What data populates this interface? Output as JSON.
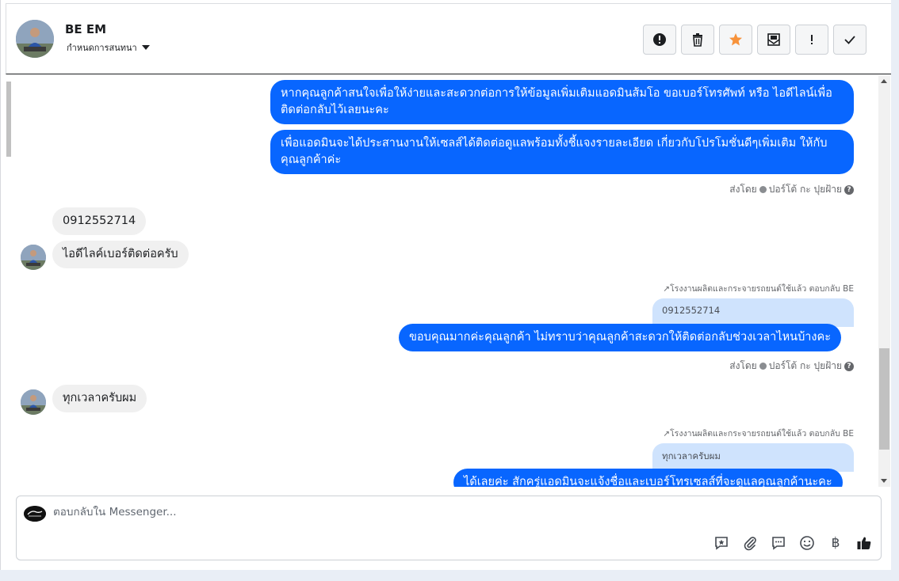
{
  "header": {
    "contact_name": "BE EM",
    "assign_label": "กำหนดการสนทนา"
  },
  "toolbar": {
    "buttons": [
      {
        "name": "report-spam",
        "icon": "alert-circle-icon"
      },
      {
        "name": "delete",
        "icon": "trash-icon"
      },
      {
        "name": "star",
        "icon": "star-icon",
        "color": "#f7923a"
      },
      {
        "name": "mark-unread",
        "icon": "envelope-icon"
      },
      {
        "name": "important",
        "icon": "exclamation-icon"
      },
      {
        "name": "mark-done",
        "icon": "checkmark-icon"
      }
    ]
  },
  "messages": {
    "m1": "หากคุณลูกค้าสนใจเพื่อให้ง่ายและสะดวกต่อการให้ข้อมูลเพิ่มเติมแอดมินส้มโอ ขอเบอร์โทรศัพท์ หรือ ไอดีไลน์เพื่อติดต่อกลับไว้เลยนะคะ",
    "m2": "เพื่อแอดมินจะได้ประสานงานให้เซลส์ได้ติดต่อดูแลพร้อมทั้งชี้แจงรายละเอียด เกี่ยวกับโปรโมชั่นดีๆเพิ่มเติม ให้กับคุณลูกค้าค่ะ",
    "sent_by_1": "ส่งโดย",
    "sender_1": "ปอร์โต้ กะ ปุยฝ้าย",
    "m3": "0912552714",
    "m4": "ไอดีไลค์เบอร์ติดต่อครับ",
    "reply_note_1": "โรงงานผลิตและกระจายรถยนต์ใช้แล้ว ตอบกลับ BE",
    "quoted_1": "0912552714",
    "m5": "ขอบคุณมากค่ะคุณลูกค้า ไม่ทราบว่าคุณลูกค้าสะดวกให้ติดต่อกลับช่วงเวลาไหนบ้างคะ",
    "sent_by_2": "ส่งโดย",
    "sender_2": "ปอร์โต้ กะ ปุยฝ้าย",
    "m6": "ทุกเวลาครับผม",
    "reply_note_2": "โรงงานผลิตและกระจายรถยนต์ใช้แล้ว ตอบกลับ BE",
    "quoted_2": "ทุกเวลาครับผม",
    "m7": "ได้เลยค่ะ สักครู่แอดมินจะแจ้งชื่อและเบอร์โทรเซลส์ที่จะดูแลคุณลูกค้านะคะ"
  },
  "composer": {
    "placeholder": "ตอบกลับใน Messenger...",
    "tools": [
      "saved-reply-icon",
      "paperclip-icon",
      "chat-bubble-icon",
      "emoji-icon",
      "baht-icon",
      "thumbs-up-icon"
    ],
    "baht_symbol": "฿"
  },
  "colors": {
    "outgoing_bubble": "#0866ff",
    "incoming_bubble": "#f0f0f0",
    "quoted_bubble": "#cfe3fd"
  }
}
